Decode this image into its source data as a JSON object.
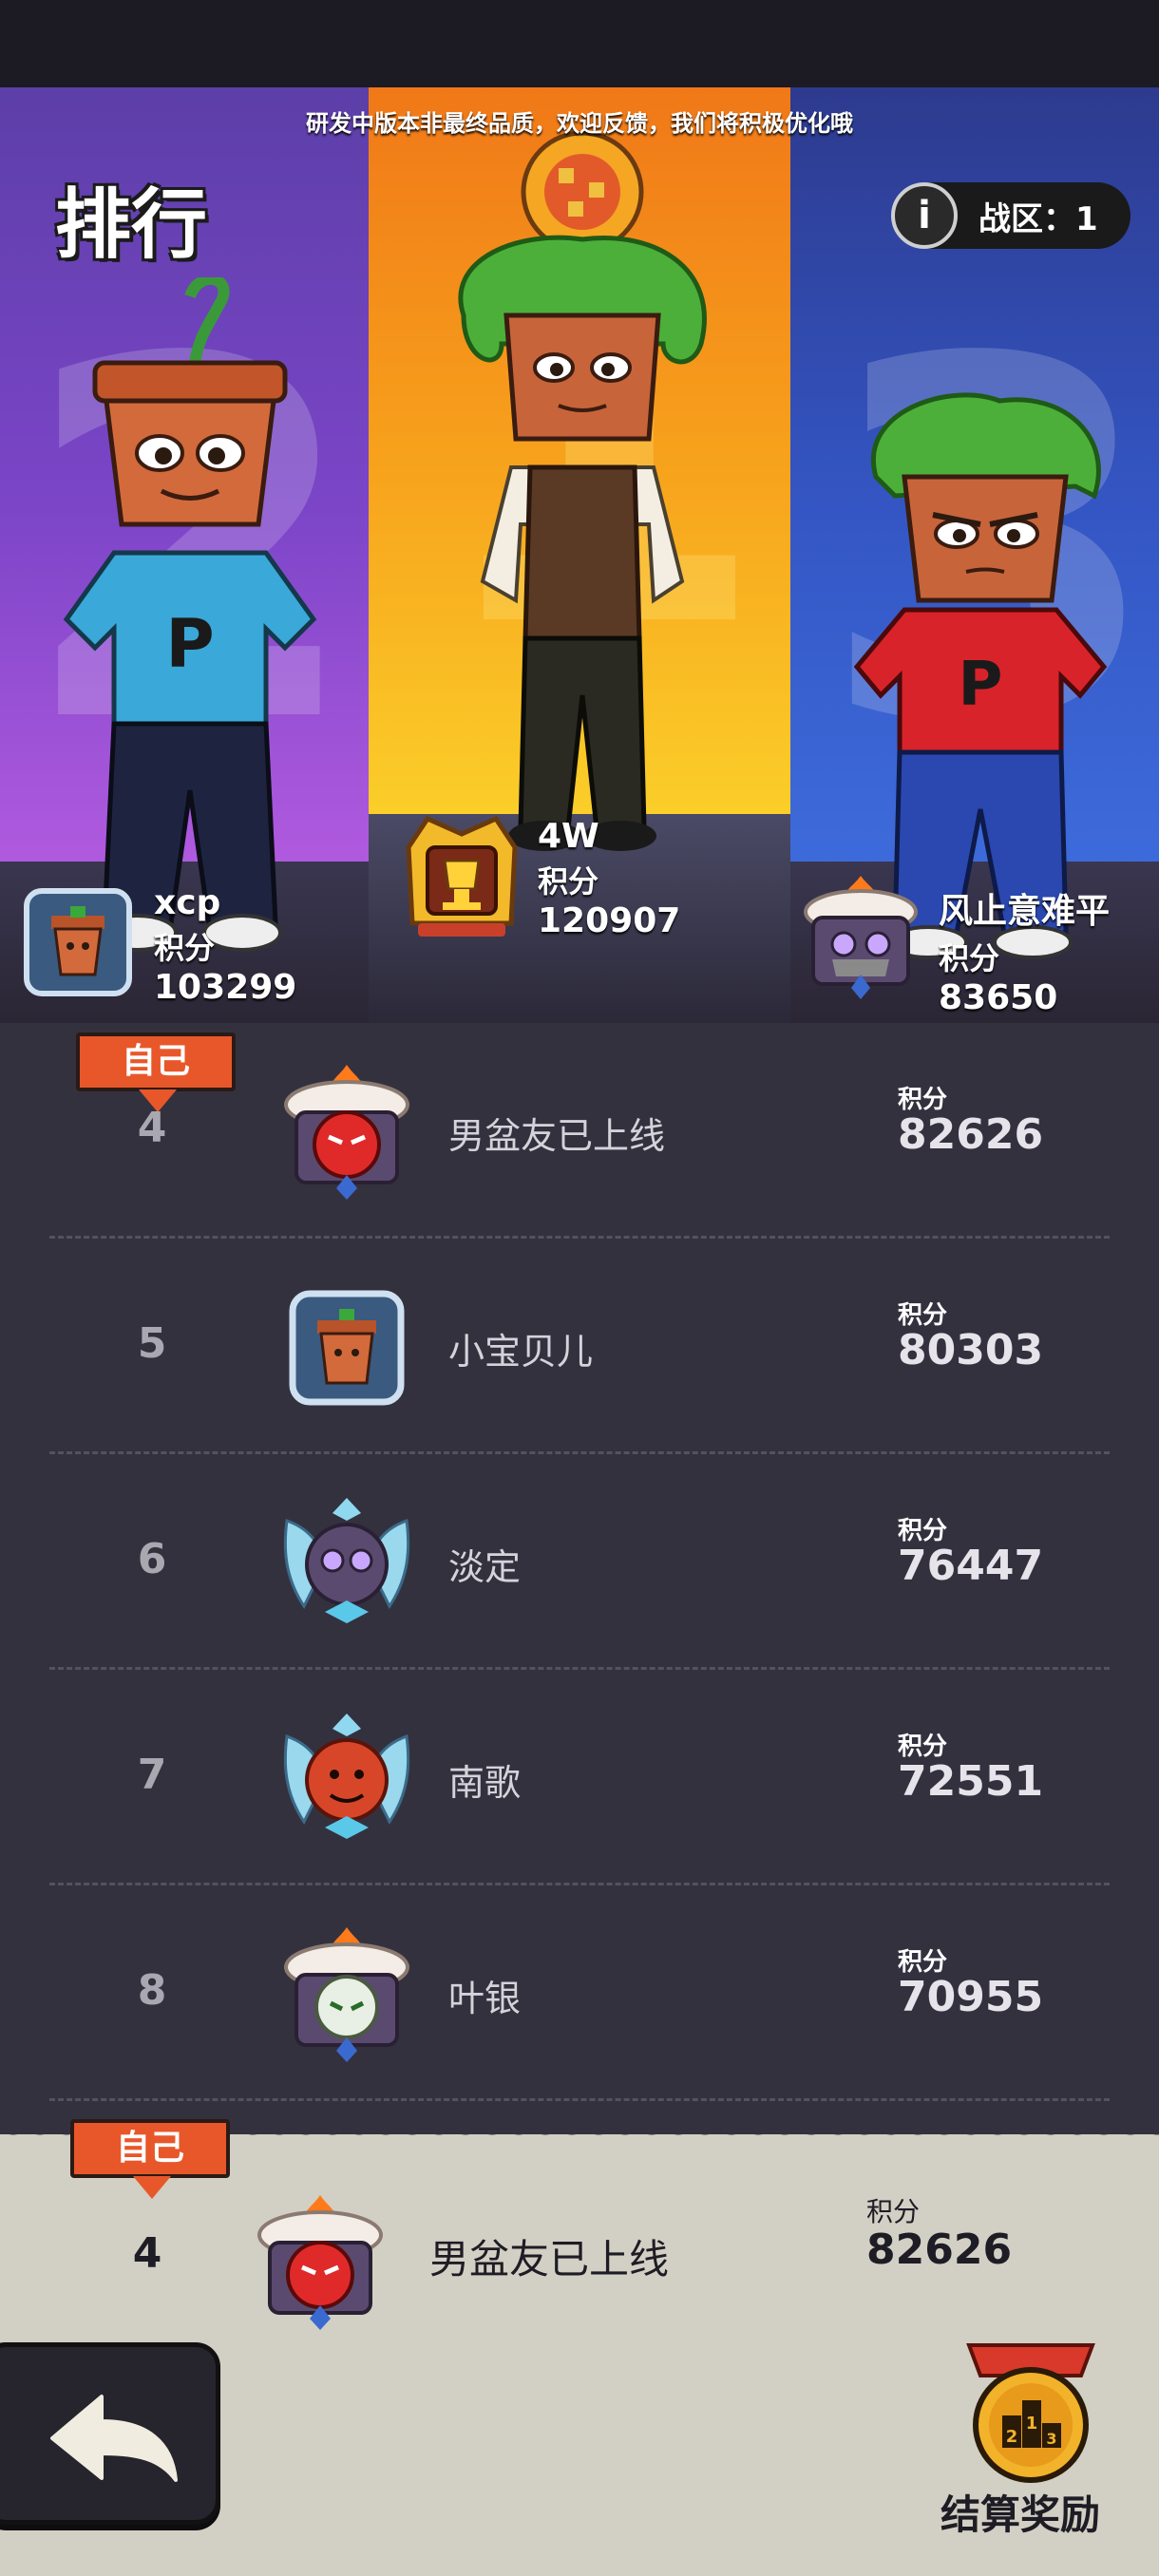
{
  "notice": "研发中版本非最终品质，欢迎反馈，我们将积极优化哦",
  "title": "排行",
  "zone": {
    "info_icon": "info-icon",
    "label": "战区：1"
  },
  "podium": {
    "first": {
      "rank_bg": "1",
      "name": "4W",
      "score_label": "积分",
      "score": "120907",
      "avatar_icon": "golden-trophy-frame-icon"
    },
    "second": {
      "rank_bg": "2",
      "name": "xcp",
      "score_label": "积分",
      "score": "103299",
      "avatar_icon": "flowerpot-avatar-icon"
    },
    "third": {
      "rank_bg": "3",
      "name": "风止意难平",
      "score_label": "积分",
      "score": "83650",
      "avatar_icon": "cake-frame-avatar-icon"
    }
  },
  "list": [
    {
      "rank": "4",
      "name": "男盆友已上线",
      "score_label": "积分",
      "score": "82626",
      "self": true,
      "self_label": "自己",
      "avatar_icon": "red-cake-frame-icon"
    },
    {
      "rank": "5",
      "name": "小宝贝儿",
      "score_label": "积分",
      "score": "80303",
      "self": false,
      "avatar_icon": "flowerpot-avatar-icon"
    },
    {
      "rank": "6",
      "name": "淡定",
      "score_label": "积分",
      "score": "76447",
      "self": false,
      "avatar_icon": "blue-bow-frame-icon"
    },
    {
      "rank": "7",
      "name": "南歌",
      "score_label": "积分",
      "score": "72551",
      "self": false,
      "avatar_icon": "blue-bow-frame-icon"
    },
    {
      "rank": "8",
      "name": "叶银",
      "score_label": "积分",
      "score": "70955",
      "self": false,
      "avatar_icon": "cake-frame-avatar-icon"
    }
  ],
  "my_rank": {
    "self_label": "自己",
    "rank": "4",
    "name": "男盆友已上线",
    "score_label": "积分",
    "score": "82626",
    "avatar_icon": "red-cake-frame-icon"
  },
  "back_button": {
    "icon": "back-arrow-icon"
  },
  "reward": {
    "icon": "medal-icon",
    "medal_text": "213",
    "label": "结算奖励"
  },
  "colors": {
    "accent_orange": "#e8572a",
    "list_bg": "#34313f",
    "bottom_bg": "#d2cfc4"
  }
}
